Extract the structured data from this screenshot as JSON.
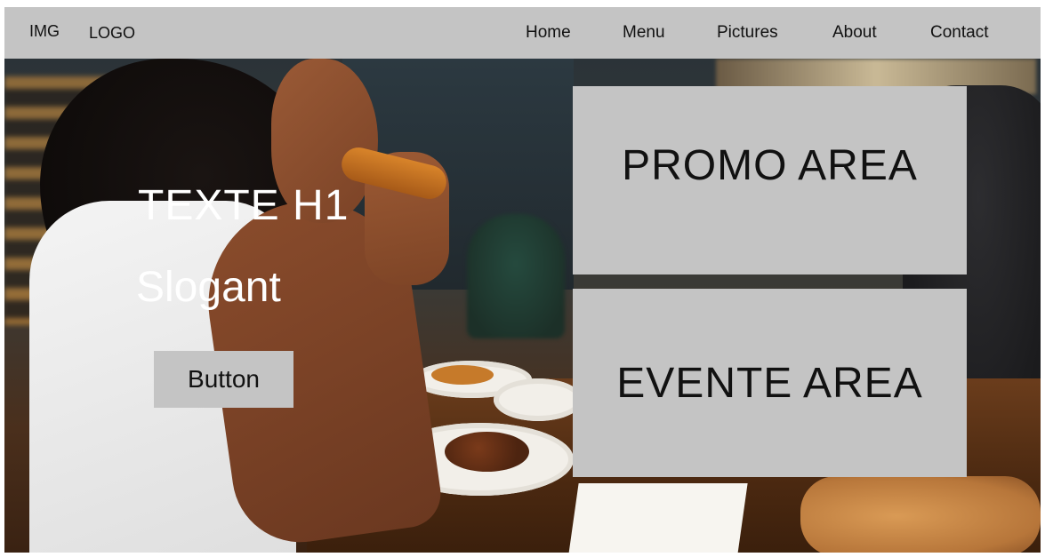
{
  "navbar": {
    "brand_img": "IMG",
    "brand_logo": "LOGO",
    "links": [
      "Home",
      "Menu",
      "Pictures",
      "About",
      "Contact"
    ]
  },
  "hero": {
    "title": "TEXTE H1",
    "slogan": "Slogant",
    "button_label": "Button"
  },
  "promo": {
    "label": "PROMO AREA"
  },
  "event": {
    "label": "EVENTE AREA"
  },
  "colors": {
    "placeholder_gray": "#c4c4c4",
    "hero_text": "#ffffff",
    "dark_text": "#111111"
  }
}
